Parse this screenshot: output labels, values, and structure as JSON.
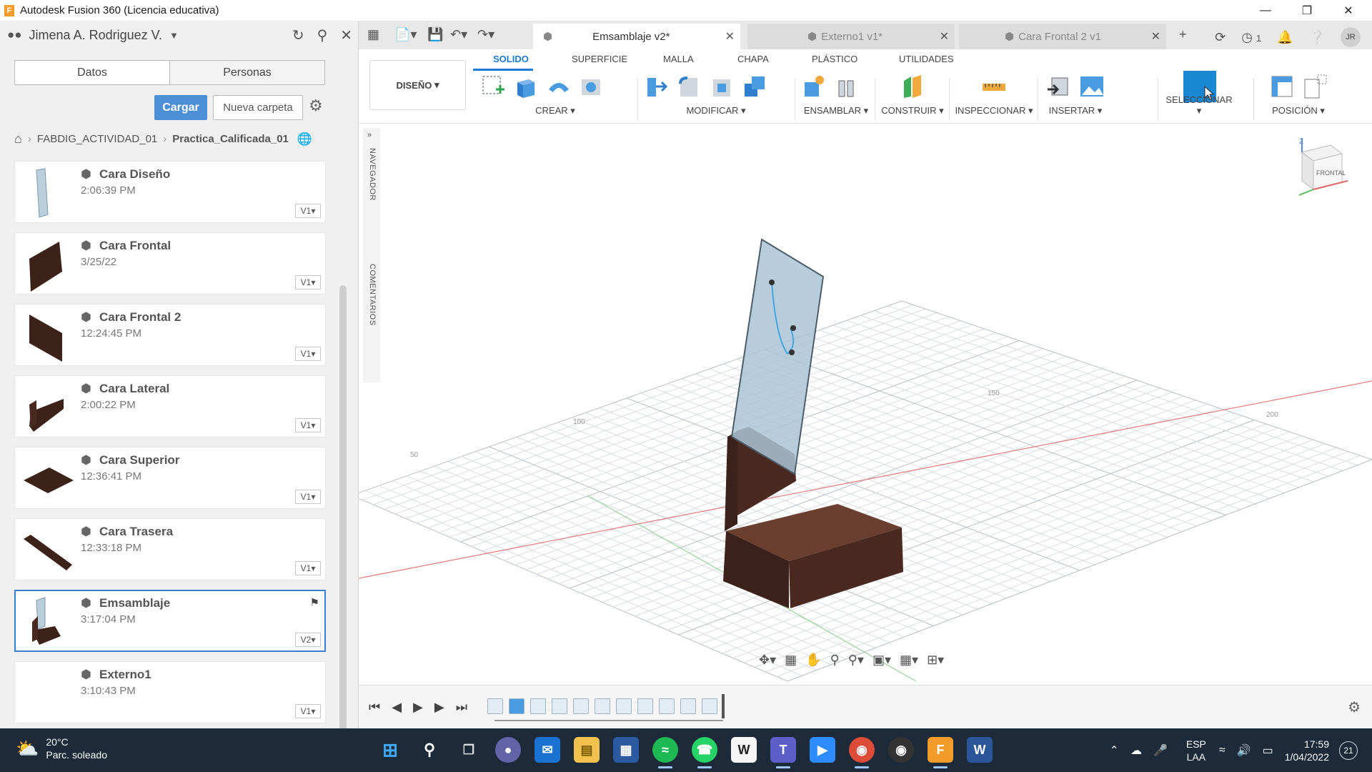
{
  "window": {
    "title": "Autodesk Fusion 360 (Licencia educativa)",
    "app_icon_letter": "F",
    "controls": [
      "minimize-icon",
      "restore-icon",
      "close-icon"
    ]
  },
  "data_panel": {
    "user_name": "Jimena A. Rodriguez V.",
    "tabs": [
      "Datos",
      "Personas"
    ],
    "upload_label": "Cargar",
    "new_folder_label": "Nueva carpeta",
    "breadcrumb": [
      "FABDIG_ACTIVIDAD_01",
      "Practica_Calificada_01"
    ],
    "files": [
      {
        "name": "Cara Diseño",
        "time": "2:06:39 PM",
        "version": "V1"
      },
      {
        "name": "Cara Frontal",
        "time": "3/25/22",
        "version": "V1"
      },
      {
        "name": "Cara Frontal 2",
        "time": "12:24:45 PM",
        "version": "V1"
      },
      {
        "name": "Cara Lateral",
        "time": "2:00:22 PM",
        "version": "V1"
      },
      {
        "name": "Cara Superior",
        "time": "12:36:41 PM",
        "version": "V1"
      },
      {
        "name": "Cara Trasera",
        "time": "12:33:18 PM",
        "version": "V1"
      },
      {
        "name": "Emsamblaje",
        "time": "3:17:04 PM",
        "version": "V2",
        "selected": true
      },
      {
        "name": "Externo1",
        "time": "3:10:43 PM",
        "version": "V1"
      }
    ]
  },
  "document_tabs": [
    {
      "label": "Emsamblaje v2*",
      "active": true
    },
    {
      "label": "Externo1 v1*",
      "active": false
    },
    {
      "label": "Cara Frontal 2 v1",
      "active": false
    }
  ],
  "header_icons": {
    "job_count": "1",
    "avatar_initials": "JR"
  },
  "toolbar": {
    "workspace": "DISEÑO",
    "ribbon_tabs": [
      "SOLIDO",
      "SUPERFICIE",
      "MALLA",
      "CHAPA",
      "PLÁSTICO",
      "UTILIDADES"
    ],
    "active_tab": "SOLIDO",
    "groups": [
      "CREAR",
      "MODIFICAR",
      "ENSAMBLAR",
      "CONSTRUIR",
      "INSPECCIONAR",
      "INSERTAR",
      "SELECCIONAR",
      "POSICIÓN"
    ]
  },
  "viewport": {
    "browser_label": "NAVEGADOR",
    "comments_label": "COMENTARIOS",
    "viewcube_face": "FRONTAL",
    "viewcube_axis": "Z",
    "grid_ticks": [
      "50",
      "100",
      "150",
      "200"
    ]
  },
  "taskbar": {
    "weather_temp": "20°C",
    "weather_text": "Parc. soleado",
    "lang_top": "ESP",
    "lang_bottom": "LAA",
    "time": "17:59",
    "date": "1/04/2022",
    "notifications": "21",
    "apps": [
      "windows-start",
      "search",
      "task-view",
      "chat",
      "mail",
      "file-explorer",
      "store",
      "spotify",
      "whatsapp",
      "notion",
      "teams",
      "zoom",
      "chrome",
      "obs",
      "fusion360",
      "word"
    ]
  },
  "colors": {
    "accent": "#1f7bd1",
    "wood": "#4a2a20",
    "glass": "#a9c3d4",
    "taskbar": "#1c2a3a"
  }
}
